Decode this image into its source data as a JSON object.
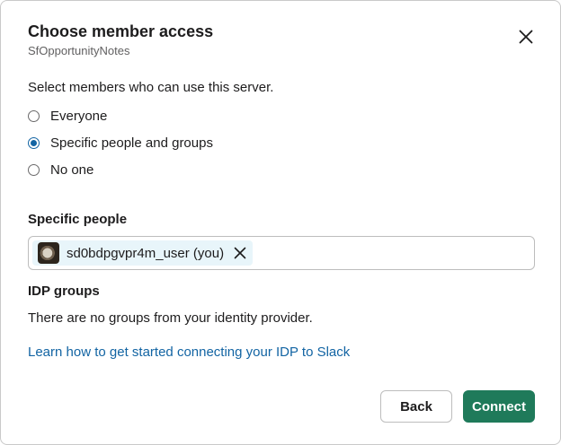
{
  "dialog": {
    "title": "Choose member access",
    "subtitle": "SfOpportunityNotes",
    "close_icon": "close-icon"
  },
  "access": {
    "prompt": "Select members who can use this server.",
    "options": [
      {
        "label": "Everyone",
        "selected": false
      },
      {
        "label": "Specific people and groups",
        "selected": true
      },
      {
        "label": "No one",
        "selected": false
      }
    ]
  },
  "specific_people": {
    "heading": "Specific people",
    "chips": [
      {
        "label": "sd0bdpgvpr4m_user (you)",
        "remove_icon": "close-icon"
      }
    ]
  },
  "idp_groups": {
    "heading": "IDP groups",
    "empty_text": "There are no groups from your identity provider.",
    "learn_link": "Learn how to get started connecting your IDP to Slack"
  },
  "footer": {
    "back_label": "Back",
    "connect_label": "Connect"
  },
  "colors": {
    "accent": "#1264a3",
    "primary_button": "#1f7a5a",
    "chip_background": "#e8f5fa"
  }
}
